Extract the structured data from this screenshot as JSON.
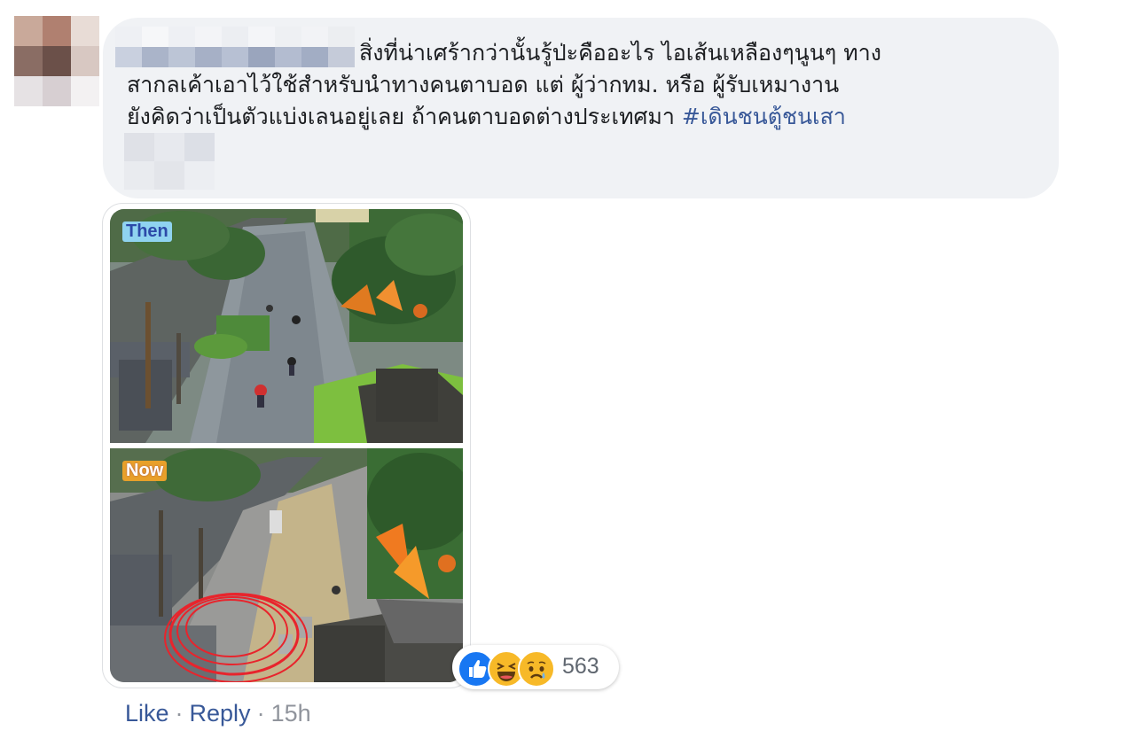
{
  "comment": {
    "author_redacted": true,
    "text_lines": [
      "สิ่งที่น่าเศร้ากว่านั้นรู้ป่ะคืออะไร ไอเส้นเหลืองๆนูนๆ ทาง",
      "สากลเค้าเอาไว้ใช้สำหรับนำทางคนตาบอด แต่ ผู้ว่ากทม. หรือ ผู้รับเหมางาน",
      "ยังคิดว่าเป็นตัวแบ่งเลนอยู่เลย ถ้าคนตาบอดต่างประเทศมา "
    ],
    "hashtag": "#เดินชนตู้ชนเสา"
  },
  "attachment": {
    "photos": [
      {
        "label": "Then"
      },
      {
        "label": "Now"
      }
    ]
  },
  "reactions": {
    "icons": [
      "like-icon",
      "haha-icon",
      "sad-icon"
    ],
    "count": "563"
  },
  "actions": {
    "like": "Like",
    "separator": "·",
    "reply": "Reply",
    "timestamp": "15h"
  },
  "colors": {
    "bubble": "#f0f2f5",
    "link": "#385898",
    "meta": "#90949c",
    "like_blue": "#1877f2",
    "reaction_yellow": "#f7b928"
  }
}
